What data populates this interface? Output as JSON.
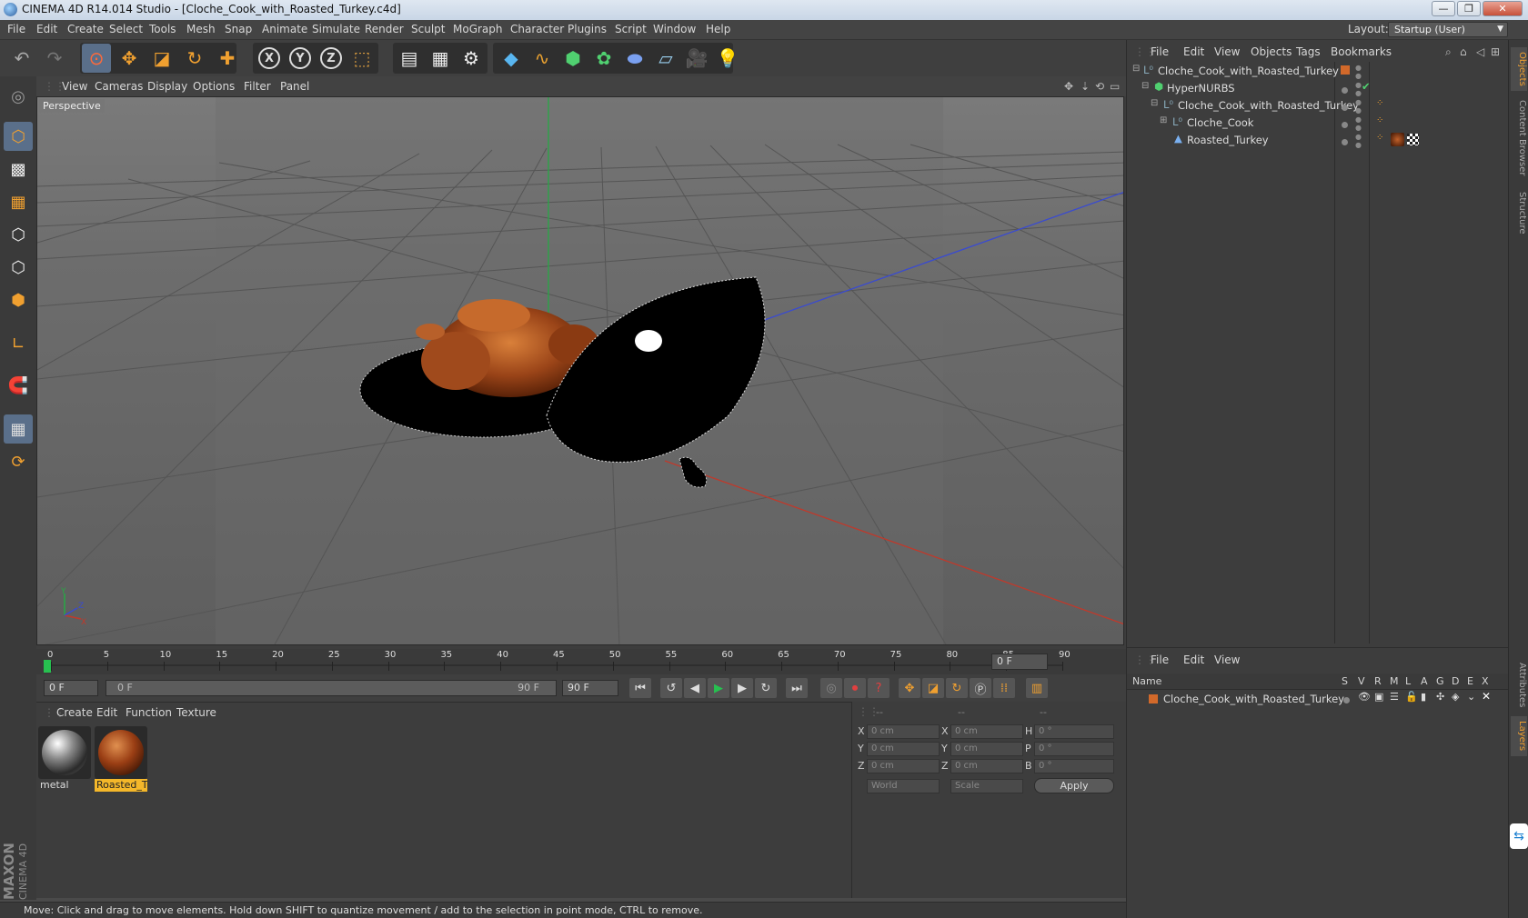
{
  "window": {
    "title": "CINEMA 4D R14.014 Studio - [Cloche_Cook_with_Roasted_Turkey.c4d]",
    "controls": [
      "—",
      "❐",
      "✕"
    ]
  },
  "menubar": {
    "items": [
      "File",
      "Edit",
      "Create",
      "Select",
      "Tools",
      "Mesh",
      "Snap",
      "Animate",
      "Simulate",
      "Render",
      "Sculpt",
      "MoGraph",
      "Character",
      "Plugins",
      "Script",
      "Window",
      "Help"
    ],
    "layout_label": "Layout:",
    "layout_value": "Startup (User)"
  },
  "viewport": {
    "menu": [
      "View",
      "Cameras",
      "Display",
      "Options",
      "Filter",
      "Panel"
    ],
    "camera_label": "Perspective"
  },
  "timeline": {
    "ticks": [
      "0",
      "5",
      "10",
      "15",
      "20",
      "25",
      "30",
      "35",
      "40",
      "45",
      "50",
      "55",
      "60",
      "65",
      "70",
      "75",
      "80",
      "85",
      "90"
    ],
    "current_frame": "0 F"
  },
  "transport": {
    "start_field": "0 F",
    "range_start": "0 F",
    "range_end": "90 F",
    "end_field": "90 F"
  },
  "materials": {
    "menu": [
      "Create",
      "Edit",
      "Function",
      "Texture"
    ],
    "items": [
      {
        "label": "metal",
        "selected": false
      },
      {
        "label": "Roasted_Tu",
        "selected": true
      }
    ]
  },
  "coordinates": {
    "headers": [
      "--",
      "--",
      "--"
    ],
    "rows": [
      {
        "a": "X",
        "av": "0 cm",
        "b": "X",
        "bv": "0 cm",
        "c": "H",
        "cv": "0 °"
      },
      {
        "a": "Y",
        "av": "0 cm",
        "b": "Y",
        "bv": "0 cm",
        "c": "P",
        "cv": "0 °"
      },
      {
        "a": "Z",
        "av": "0 cm",
        "b": "Z",
        "bv": "0 cm",
        "c": "B",
        "cv": "0 °"
      }
    ],
    "mode": "World",
    "scale": "Scale",
    "apply": "Apply"
  },
  "object_manager": {
    "menu": [
      "File",
      "Edit",
      "View",
      "Objects",
      "Tags",
      "Bookmarks"
    ],
    "objects": [
      {
        "name": "Cloche_Cook_with_Roasted_Turkey",
        "indent": 0
      },
      {
        "name": "HyperNURBS",
        "indent": 1
      },
      {
        "name": "Cloche_Cook_with_Roasted_Turkey",
        "indent": 2
      },
      {
        "name": "Cloche_Cook",
        "indent": 3
      },
      {
        "name": "Roasted_Turkey",
        "indent": 3
      }
    ]
  },
  "layer_manager": {
    "menu": [
      "File",
      "Edit",
      "View"
    ],
    "name_header": "Name",
    "columns": [
      "S",
      "V",
      "R",
      "M",
      "L",
      "A",
      "G",
      "D",
      "E",
      "X"
    ],
    "layers": [
      {
        "name": "Cloche_Cook_with_Roasted_Turkey",
        "color": "#d2692a"
      }
    ]
  },
  "right_tabs": [
    "Objects",
    "Content Browser",
    "Structure",
    "Attributes",
    "Layers"
  ],
  "status": "Move: Click and drag to move elements. Hold down SHIFT to quantize movement / add to the selection in point mode, CTRL to remove.",
  "brand": {
    "line1": "MAXON",
    "line2": "CINEMA 4D"
  },
  "colors": {
    "accent": "#f0a030",
    "selection": "#f4b72a",
    "x_axis": "#c0392b",
    "y_axis": "#27a845",
    "z_axis": "#3a4bd0"
  }
}
